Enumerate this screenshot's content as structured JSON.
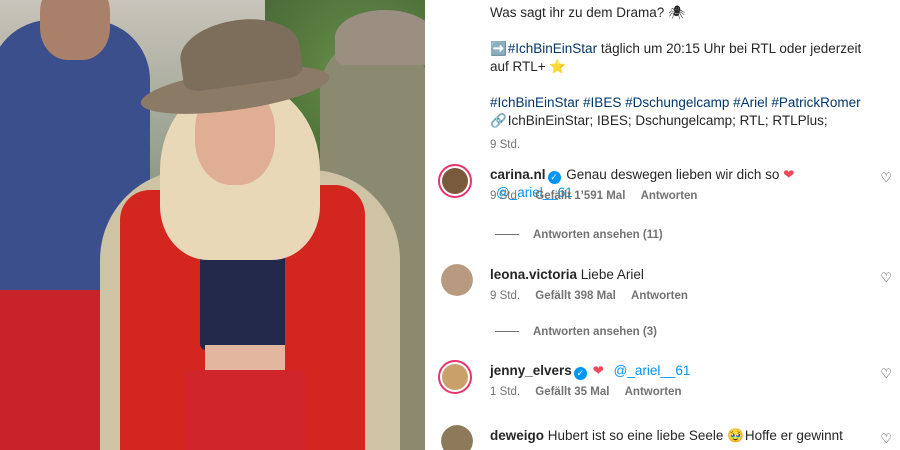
{
  "caption": {
    "line1": "Was sagt ihr zu dem Drama? ",
    "line1_emoji": "🕷",
    "line2_icon": "➡️",
    "line2_hashtag": "#IchBinEinStar",
    "line2_text": " täglich um 20:15 Uhr bei RTL oder jederzeit",
    "line3_text": "auf RTL+ ",
    "line3_emoji": "⭐",
    "hashtags": "#IchBinEinStar #IBES #Dschungelcamp #Ariel #PatrickRomer",
    "tags_icon": "🔗",
    "tags": "IchBinEinStar; IBES; Dschungelcamp; RTL; RTLPlus;",
    "time": "9 Std."
  },
  "comments": [
    {
      "username": "carina.nl",
      "verified": true,
      "text": " Genau deswegen lieben wir dich so ",
      "heart": "❤",
      "mention": "@_ariel__61",
      "time": "9 Std.",
      "likes": "Gefällt 1’591 Mal",
      "reply_label": "Antworten",
      "view_replies": "Antworten ansehen (11)",
      "avatar_color": "#7a5a3c"
    },
    {
      "username": "leona.victoria",
      "verified": false,
      "text": " Liebe Ariel",
      "time": "9 Std.",
      "likes": "Gefällt 398 Mal",
      "reply_label": "Antworten",
      "view_replies": "Antworten ansehen (3)",
      "avatar_color": "#b89a80"
    },
    {
      "username": "jenny_elvers",
      "verified": true,
      "heart": "❤",
      "mention": "@_ariel__61",
      "time": "1 Std.",
      "likes": "Gefällt 35 Mal",
      "reply_label": "Antworten",
      "avatar_color": "#c9a06a"
    },
    {
      "username": "deweigo",
      "verified": false,
      "text": " Hubert ist so eine liebe Seele ",
      "emoji": "🥹",
      "text2": " Hoffe er gewinnt",
      "avatar_color": "#8c7a5a"
    }
  ],
  "icons": {
    "like": "heart-outline-icon",
    "verified": "verified-badge-icon"
  },
  "colors": {
    "link": "#00376b",
    "mention": "#0095f6",
    "verified": "#0095f6",
    "heart": "#ed4956",
    "muted": "#737373"
  }
}
